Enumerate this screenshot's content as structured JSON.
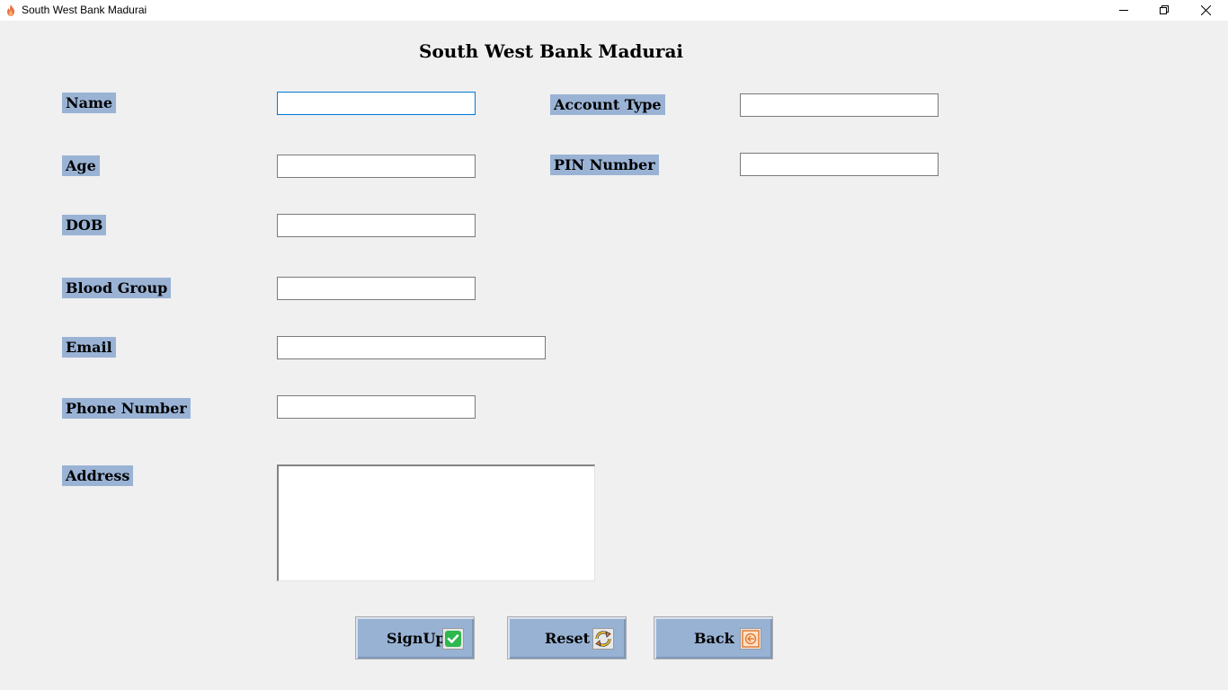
{
  "window": {
    "title": "South West Bank Madurai"
  },
  "form": {
    "heading": "South West Bank Madurai",
    "labels": {
      "name": "Name",
      "age": "Age",
      "dob": "DOB",
      "blood_group": "Blood Group",
      "email": "Email",
      "phone": "Phone Number",
      "address": "Address",
      "account_type": "Account Type",
      "pin": "PIN Number"
    },
    "values": {
      "name": "",
      "age": "",
      "dob": "",
      "blood_group": "",
      "email": "",
      "phone": "",
      "address": "",
      "account_type": "",
      "pin": ""
    }
  },
  "buttons": {
    "signup": "SignUp",
    "reset": "Reset",
    "back": "Back"
  },
  "icons": {
    "app": "flame-icon",
    "signup": "check-icon",
    "reset": "refresh-icon",
    "back": "back-arrow-icon"
  },
  "colors": {
    "label_bg": "#9ab3d5",
    "button_bg": "#98b2d4",
    "window_bg": "#f0f0f0",
    "check_green": "#2db84d",
    "accent_orange": "#e87a2a"
  }
}
